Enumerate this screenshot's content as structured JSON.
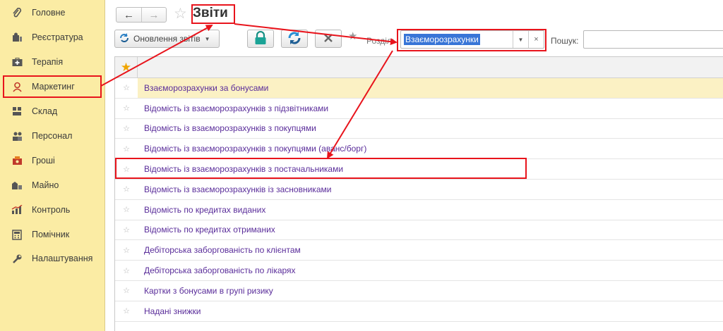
{
  "sidebar": {
    "items": [
      {
        "label": "Головне",
        "icon": "paperclip-icon"
      },
      {
        "label": "Реєстратура",
        "icon": "registry-icon"
      },
      {
        "label": "Терапія",
        "icon": "medkit-icon"
      },
      {
        "label": "Маркетинг",
        "icon": "marketing-person-icon"
      },
      {
        "label": "Склад",
        "icon": "warehouse-icon"
      },
      {
        "label": "Персонал",
        "icon": "staff-icon"
      },
      {
        "label": "Гроші",
        "icon": "money-icon"
      },
      {
        "label": "Майно",
        "icon": "property-icon"
      },
      {
        "label": "Контроль",
        "icon": "control-chart-icon"
      },
      {
        "label": "Помічник",
        "icon": "assistant-calculator-icon"
      },
      {
        "label": "Налаштування",
        "icon": "settings-wrench-icon"
      }
    ]
  },
  "header": {
    "back_glyph": "←",
    "forward_glyph": "→",
    "title": "Звіти"
  },
  "toolbar": {
    "update_label": "Оновлення звітів",
    "section_label": "Розділ:",
    "section_value": "Взаєморозрахунки",
    "clear_glyph": "×",
    "search_label": "Пошук:",
    "search_value": ""
  },
  "reports": [
    "Взаєморозрахунки за бонусами",
    "Відомість із взаєморозрахунків з підзвітниками",
    "Відомість із взаєморозрахунків з покупцями",
    "Відомість із взаєморозрахунків з покупцями (аванс/борг)",
    "Відомість із взаєморозрахунків з постачальниками",
    "Відомість із взаєморозрахунків із засновниками",
    "Відомість по кредитах виданих",
    "Відомість по кредитах отриманих",
    "Дебіторська заборгованість по клієнтам",
    "Дебіторська заборгованість по лікарях",
    "Картки з бонусами в групі ризику",
    "Надані знижки"
  ],
  "colors": {
    "sidebar_bg": "#fbeca4",
    "link": "#5a2d9a",
    "selected_row": "#fbf1c4",
    "annotation": "#e8141c"
  }
}
